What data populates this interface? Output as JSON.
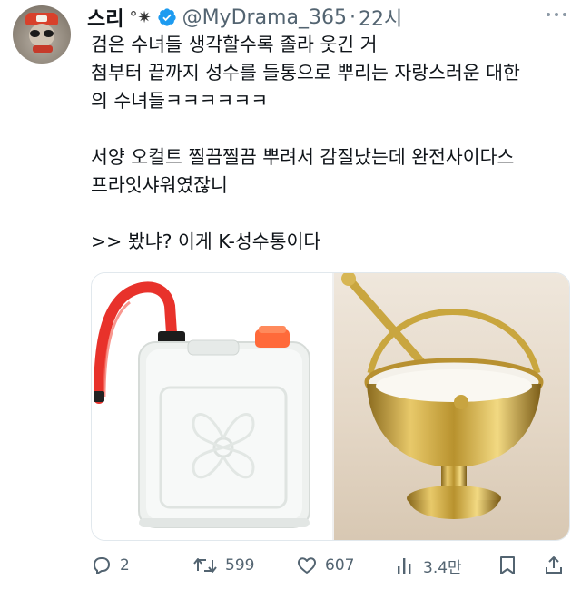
{
  "author": {
    "display_name": "스리",
    "name_decoration": "°✷",
    "handle": "@MyDrama_365",
    "separator": "·",
    "time": "22시",
    "avatar_icon": "monkey-avatar-icon"
  },
  "tweet": {
    "lines": [
      "검은 수녀들 생각할수록 졸라 웃긴 거",
      "첨부터 끝까지 성수를 들통으로 뿌리는 자랑스러운 대한",
      "의 수녀들ㅋㅋㅋㅋㅋㅋ",
      "",
      "서양 오컬트 찔끔찔끔 뿌려서 감질났는데 완전사이다스",
      "프라잇샤워였잖니",
      "",
      ">> 봤냐? 이게 K-성수통이다"
    ]
  },
  "media": {
    "left_image": "plastic-water-jug-with-red-spout",
    "right_image": "brass-holy-water-bucket-with-sprinkler"
  },
  "actions": {
    "reply_count": "2",
    "retweet_count": "599",
    "like_count": "607",
    "view_count": "3.4만"
  },
  "colors": {
    "text": "#0f1419",
    "secondary": "#536471",
    "verified": "#1d9bf0"
  }
}
